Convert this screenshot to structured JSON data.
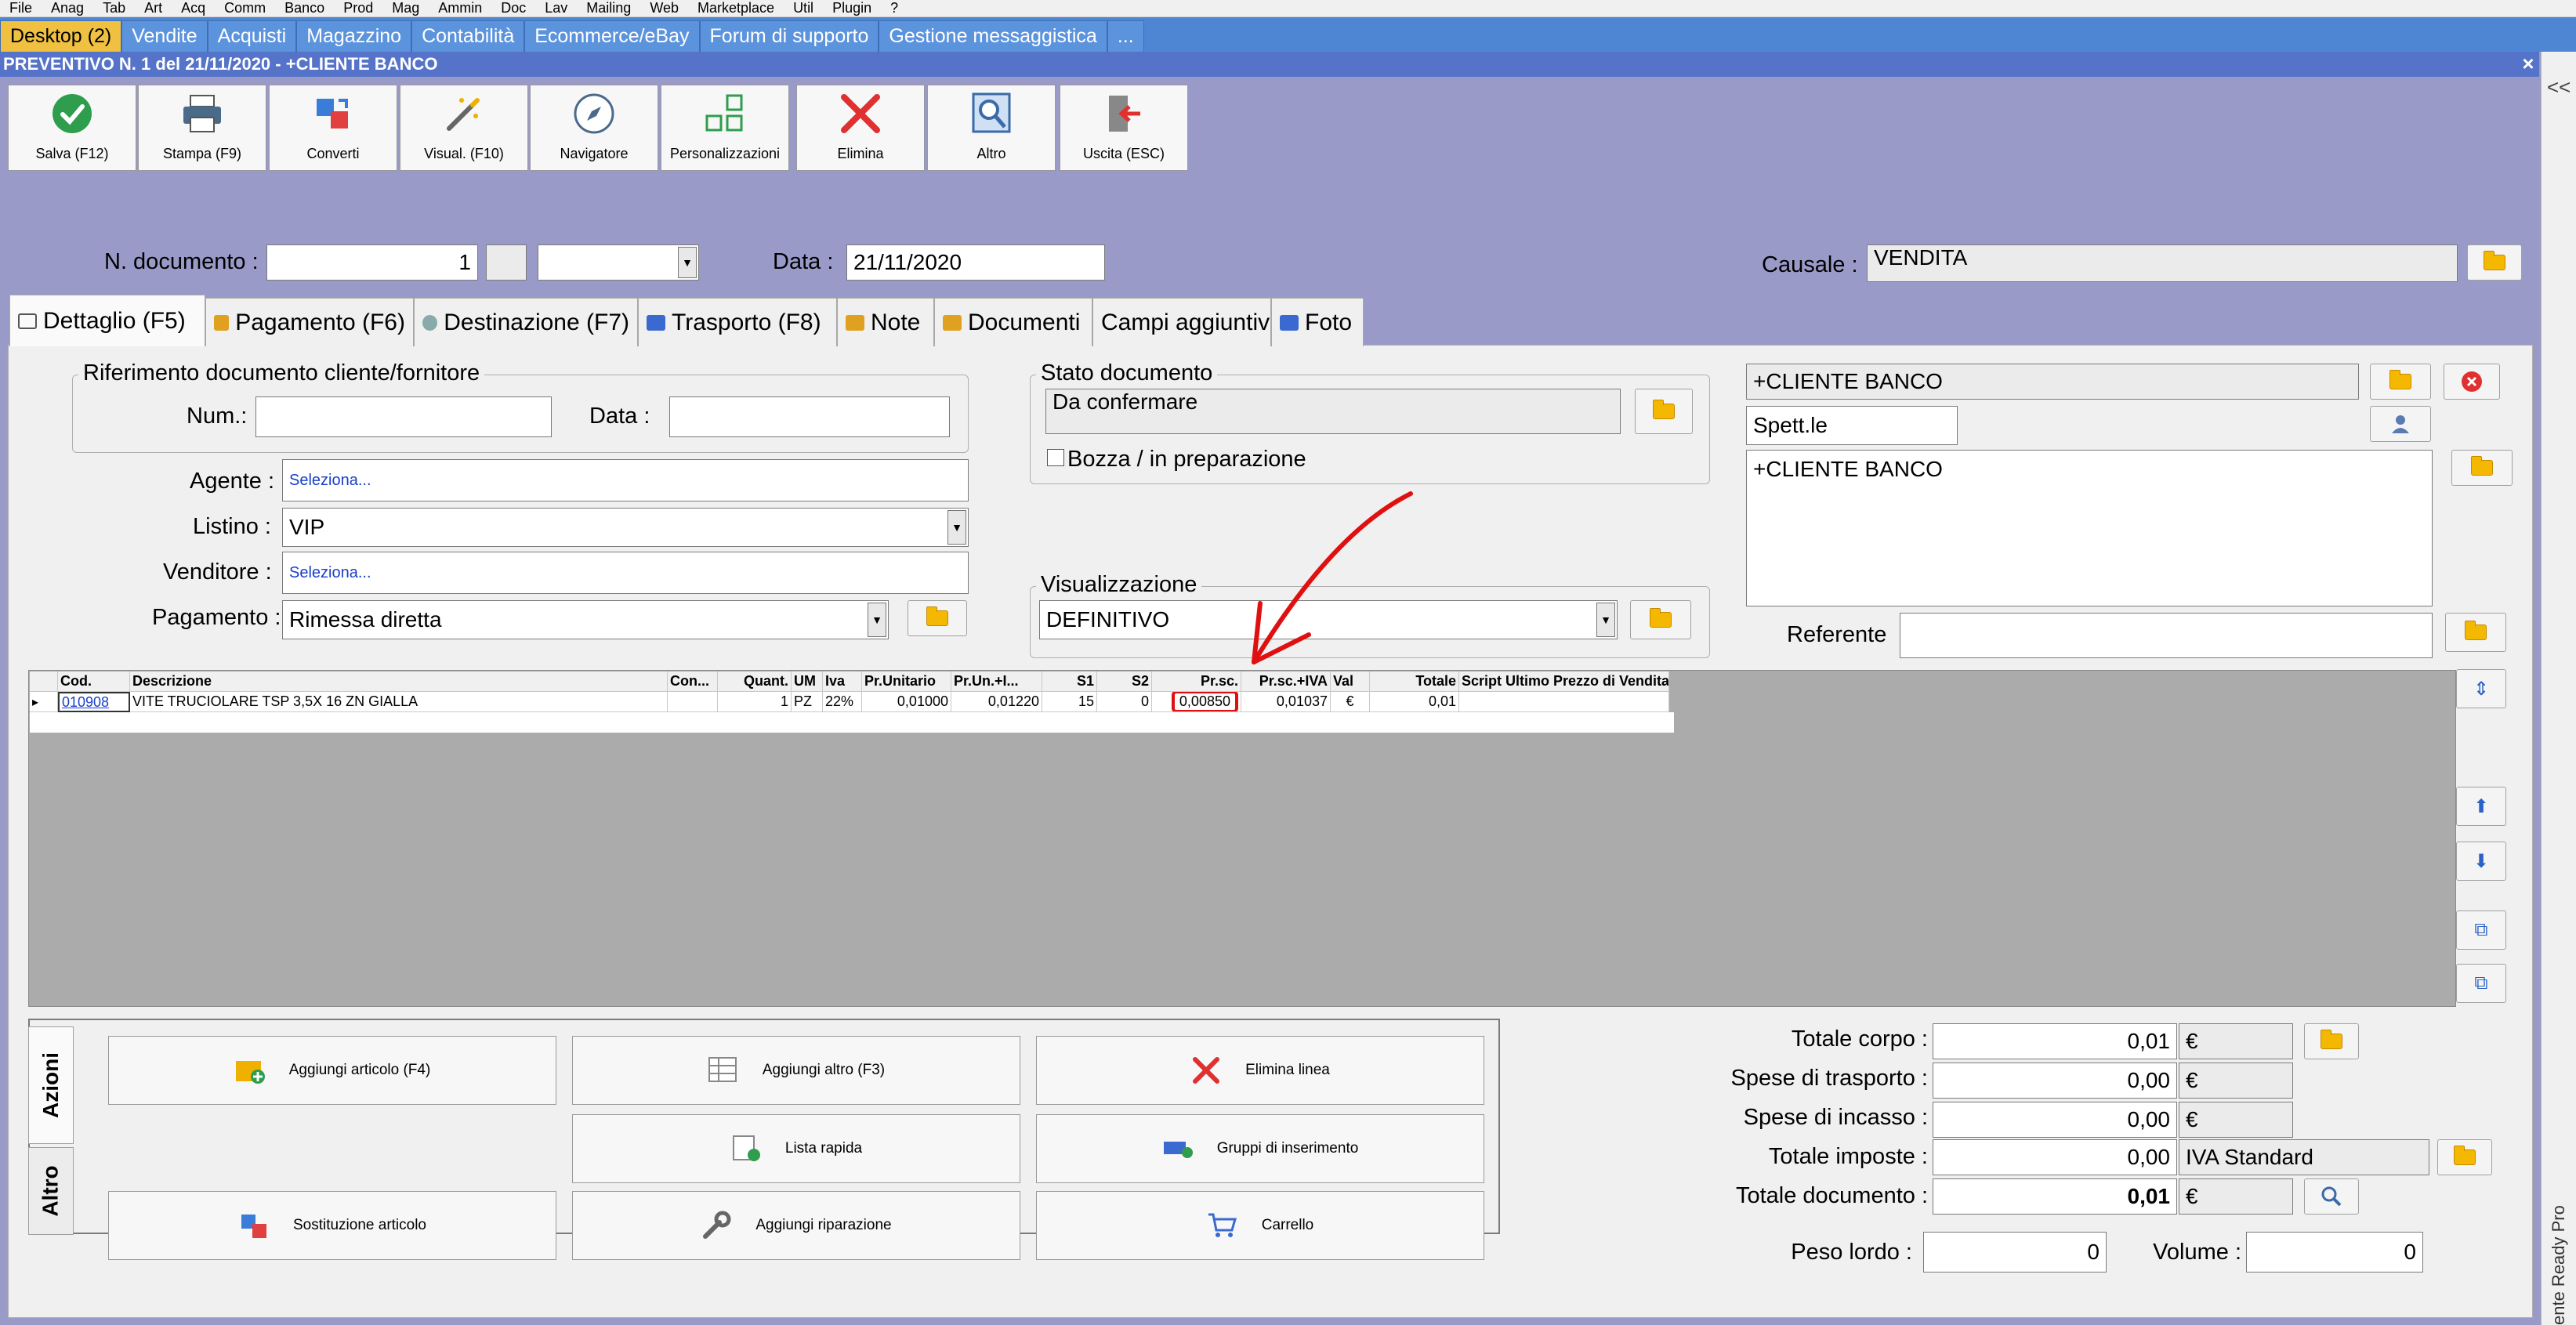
{
  "menu": [
    "File",
    "Anag",
    "Tab",
    "Art",
    "Acq",
    "Comm",
    "Banco",
    "Prod",
    "Mag",
    "Ammin",
    "Doc",
    "Lav",
    "Mailing",
    "Web",
    "Marketplace",
    "Util",
    "Plugin",
    "?"
  ],
  "window_tabs": [
    "Desktop (2)",
    "Vendite",
    "Acquisti",
    "Magazzino",
    "Contabilità",
    "Ecommerce/eBay",
    "Forum di supporto",
    "Gestione messaggistica",
    "..."
  ],
  "window_title": "PREVENTIVO N. 1 del 21/11/2020 - +CLIENTE BANCO",
  "close_glyph": "×",
  "side_arrow": "<<",
  "side_text": "ente Ready Pro",
  "toolbar": {
    "save": "Salva (F12)",
    "print": "Stampa (F9)",
    "convert": "Converti",
    "view": "Visual. (F10)",
    "navigator": "Navigatore",
    "custom": "Personalizzazioni",
    "delete": "Elimina",
    "other": "Altro",
    "exit": "Uscita (ESC)"
  },
  "header": {
    "doc_number_label": "N. documento :",
    "doc_number": "1",
    "date_label": "Data :",
    "date": "21/11/2020",
    "causale_label": "Causale :",
    "causale": "VENDITA"
  },
  "tabs": [
    "Dettaglio (F5)",
    "Pagamento (F6)",
    "Destinazione (F7)",
    "Trasporto (F8)",
    "Note",
    "Documenti",
    "Campi aggiuntivi",
    "Foto"
  ],
  "reference": {
    "group_label": "Riferimento documento cliente/fornitore",
    "num_label": "Num.:",
    "data_label": "Data :",
    "num_value": "",
    "data_value": ""
  },
  "fields": {
    "agente_label": "Agente :",
    "agente": "Seleziona...",
    "listino_label": "Listino :",
    "listino": "VIP",
    "venditore_label": "Venditore :",
    "venditore": "Seleziona...",
    "pagamento_label": "Pagamento :",
    "pagamento": "Rimessa diretta"
  },
  "status": {
    "group_label": "Stato documento",
    "value": "Da confermare",
    "draft_label": "Bozza / in preparazione",
    "draft_checked": false
  },
  "view": {
    "group_label": "Visualizzazione",
    "value": "DEFINITIVO"
  },
  "customer": {
    "name": "+CLIENTE BANCO",
    "title": "Spett.le",
    "address": "+CLIENTE BANCO",
    "referente_label": "Referente",
    "referente": ""
  },
  "grid": {
    "columns": [
      "",
      "Cod.",
      "Descrizione",
      "Con...",
      "Quant.",
      "UM",
      "Iva",
      "Pr.Unitario",
      "Pr.Un.+I...",
      "S1",
      "S2",
      "Pr.sc.",
      "Pr.sc.+IVA",
      "Val",
      "Totale",
      "Script Ultimo Prezzo di Vendita"
    ],
    "rows": [
      {
        "marker": "▸",
        "cod": "010908",
        "desc": "VITE TRUCIOLARE TSP  3,5X 16  ZN GIALLA",
        "con": "",
        "quant": "1",
        "um": "PZ",
        "iva": "22%",
        "pr_unit": "0,01000",
        "pr_unit_iva": "0,01220",
        "s1": "15",
        "s2": "0",
        "pr_sc": "0,00850",
        "pr_sc_iva": "0,01037",
        "val": "€",
        "totale": "0,01",
        "script": ""
      }
    ],
    "highlight_color": "#e01010"
  },
  "actions": {
    "tab_main": "Azioni",
    "tab_other": "Altro",
    "add_article": "Aggiungi articolo (F4)",
    "add_other": "Aggiungi altro (F3)",
    "delete_line": "Elimina linea",
    "quick_list": "Lista rapida",
    "insert_groups": "Gruppi di inserimento",
    "replace_article": "Sostituzione articolo",
    "add_repair": "Aggiungi riparazione",
    "cart": "Carrello"
  },
  "totals": {
    "corpo_label": "Totale corpo :",
    "corpo": "0,01",
    "trasporto_label": "Spese di trasporto :",
    "trasporto": "0,00",
    "incasso_label": "Spese di incasso :",
    "incasso": "0,00",
    "imposte_label": "Totale imposte :",
    "imposte": "0,00",
    "iva_type": "IVA Standard",
    "documento_label": "Totale documento :",
    "documento": "0,01",
    "currency": "€",
    "peso_label": "Peso lordo :",
    "peso": "0",
    "volume_label": "Volume :",
    "volume": "0"
  }
}
